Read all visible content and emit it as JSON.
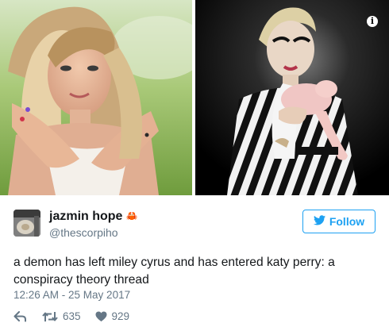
{
  "icons": {
    "info": "info-icon",
    "emoji": "crab-emoji",
    "twitter_bird": "twitter-bird-icon",
    "reply": "reply-icon",
    "retweet": "retweet-icon",
    "like": "heart-icon"
  },
  "colors": {
    "twitter_blue": "#1da1f2",
    "text": "#14171a",
    "secondary": "#657786"
  },
  "photos": {
    "info_glyph": "i"
  },
  "tweet": {
    "display_name": "jazmin hope",
    "name_emoji": "🦀",
    "handle": "@thescorpiho",
    "follow_label": "Follow",
    "text_line1": "a demon has left miley cyrus and has entered katy perry: a",
    "text_line2": "conspiracy theory thread",
    "timestamp": "12:26 AM - 25 May 2017",
    "retweets": "635",
    "likes": "929"
  }
}
